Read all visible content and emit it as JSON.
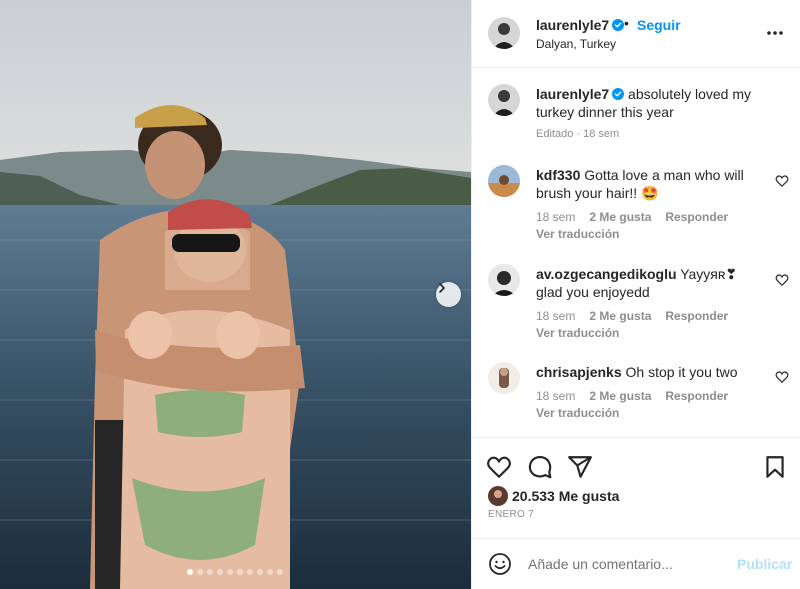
{
  "post": {
    "author": "laurenlyle7",
    "follow_label": "Seguir",
    "separator": "•",
    "location": "Dalyan, Turkey",
    "verified": true,
    "caption_text": "absolutely loved my turkey dinner this year",
    "caption_meta": "Editado · 18 sem",
    "likes": "20.533 Me gusta",
    "date": "ENERO 7"
  },
  "carousel": {
    "count": 10,
    "current": 1
  },
  "comments": [
    {
      "user": "kdf330",
      "text": "Gotta love a man who will brush your hair!! 🤩",
      "time": "18 sem",
      "likes": "2 Me gusta",
      "reply": "Responder",
      "translate": "Ver traducción"
    },
    {
      "user": "av.ozgecangedikoglu",
      "text": "Yayyяʀ❣ glad you enjoyedd",
      "time": "18 sem",
      "likes": "2 Me gusta",
      "reply": "Responder",
      "translate": "Ver traducción"
    },
    {
      "user": "chrisapjenks",
      "text": "Oh stop it you two",
      "time": "18 sem",
      "likes": "2 Me gusta",
      "reply": "Responder",
      "translate": "Ver traducción"
    }
  ],
  "add_comment": {
    "placeholder": "Añade un comentario...",
    "publish_label": "Publicar"
  },
  "icons": {
    "verified": "verified-badge-icon",
    "more": "more-options-icon",
    "heart": "heart-icon",
    "comment": "comment-icon",
    "share": "share-icon",
    "save": "bookmark-icon",
    "emoji": "emoji-icon",
    "next": "chevron-right-icon"
  },
  "colors": {
    "accent": "#0095f6",
    "verified": "#0095f6",
    "muted": "#8e8e8e",
    "publish_disabled": "#b2dffc"
  }
}
